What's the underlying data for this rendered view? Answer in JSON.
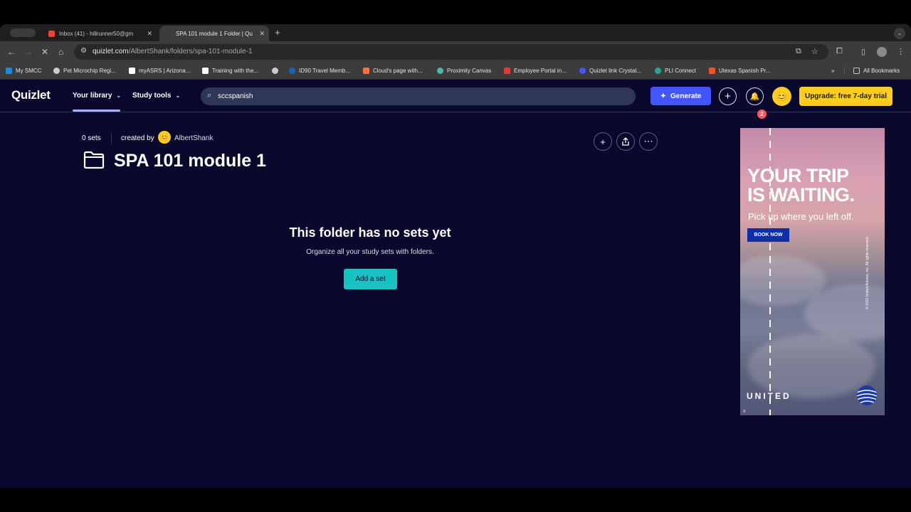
{
  "browser": {
    "tabs": [
      {
        "title": "Inbox (41) - hillrunner50@gm",
        "active": false,
        "favicon_color": "#ea4335"
      },
      {
        "title": "SPA 101 module 1 Folder | Qu",
        "active": true,
        "favicon_color": "#4255ff"
      }
    ],
    "new_tab_icon": "plus",
    "url_host": "quizlet.com",
    "url_path": "/AlbertShank/folders/spa-101-module-1",
    "bookmarks": [
      {
        "label": "My SMCC",
        "color": "#1e88e5"
      },
      {
        "label": "Pet Microchip Regi...",
        "color": "#cccccc"
      },
      {
        "label": "myASRS | Arizona...",
        "color": "#ffffff"
      },
      {
        "label": "Training with the...",
        "color": "#ffffff"
      },
      {
        "label": "",
        "color": "#cccccc"
      },
      {
        "label": "ID90 Travel Memb...",
        "color": "#1565c0"
      },
      {
        "label": "Cloud's page with...",
        "color": "#ff7043"
      },
      {
        "label": "Proximity Canvas",
        "color": "#4db6ac"
      },
      {
        "label": "Employee Portal in...",
        "color": "#e53935"
      },
      {
        "label": "Quizlet link Crystal...",
        "color": "#4255ff"
      },
      {
        "label": "PLI Connect",
        "color": "#26a69a"
      },
      {
        "label": "Utexas Spanish Pr...",
        "color": "#f4511e"
      }
    ],
    "more_bookmarks": "»",
    "all_bookmarks": "All Bookmarks"
  },
  "header": {
    "logo": "Quizlet",
    "nav": [
      {
        "label": "Your library",
        "chevron": "⌄"
      },
      {
        "label": "Study tools",
        "chevron": "⌄"
      }
    ],
    "search_value": "sccspanish",
    "generate_label": "Generate",
    "notification_count": "2",
    "upgrade_label": "Upgrade: free 7-day trial"
  },
  "folder": {
    "sets_count": "0 sets",
    "created_by_label": "created by",
    "author": "AlbertShank",
    "title": "SPA 101 module 1"
  },
  "empty_state": {
    "title": "This folder has no sets yet",
    "subtitle": "Organize all your study sets with folders.",
    "button": "Add a set"
  },
  "ad": {
    "headline_line1": "YOUR TRIP",
    "headline_line2": "IS WAITING.",
    "tagline": "Pick up where you left off.",
    "cta": "BOOK NOW",
    "brand": "UNITED",
    "legal": "© 2022 United Airlines, Inc. All rights reserved."
  },
  "colors": {
    "background": "#0a092d",
    "primary": "#4255ff",
    "upgrade": "#ffcd1f",
    "add_set": "#18c2c1"
  }
}
